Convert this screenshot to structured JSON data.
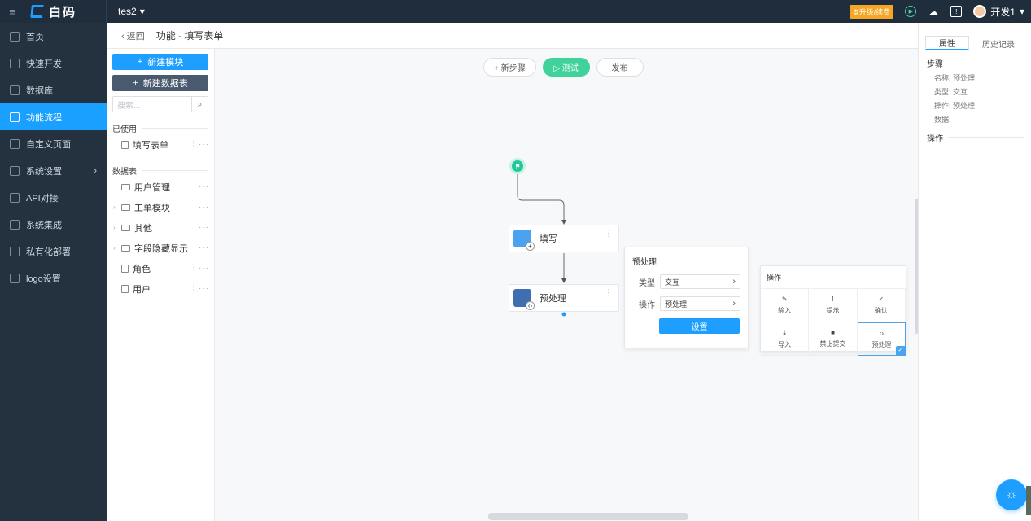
{
  "topbar": {
    "menu_icon": "≡",
    "logo_text": "白码",
    "project": "tes2",
    "upgrade_label": "升级/续费",
    "user_name": "开发1"
  },
  "sidebar": {
    "items": [
      {
        "label": "首页",
        "icon": "home-icon"
      },
      {
        "label": "快速开发",
        "icon": "cube-icon"
      },
      {
        "label": "数据库",
        "icon": "database-icon"
      },
      {
        "label": "功能流程",
        "icon": "flow-icon"
      },
      {
        "label": "自定义页面",
        "icon": "page-icon"
      },
      {
        "label": "系统设置",
        "icon": "monitor-icon"
      },
      {
        "label": "API对接",
        "icon": "api-icon"
      },
      {
        "label": "系统集成",
        "icon": "integration-icon"
      },
      {
        "label": "私有化部署",
        "icon": "deploy-icon"
      },
      {
        "label": "logo设置",
        "icon": "logo-icon"
      }
    ]
  },
  "subbar": {
    "back_label": "返回",
    "breadcrumb": "功能 - 填写表单"
  },
  "leftpanel": {
    "new_module": "新建模块",
    "new_table": "新建数据表",
    "search_placeholder": "搜索...",
    "used_section": "已使用",
    "used_items": [
      "填写表单"
    ],
    "tables_section": "数据表",
    "table_items": [
      "用户管理",
      "工单模块",
      "其他",
      "字段隐藏显示",
      "角色",
      "用户"
    ]
  },
  "canvas": {
    "add_step": "+ 新步骤",
    "test": "▷ 测试",
    "publish": "发布",
    "node1_label": "填写",
    "node2_label": "预处理"
  },
  "preprocess_panel": {
    "title": "预处理",
    "type_label": "类型",
    "type_value": "交互",
    "op_label": "操作",
    "op_value": "预处理",
    "set_button": "设置"
  },
  "op_panel": {
    "title": "操作",
    "items": [
      "输入",
      "提示",
      "确认",
      "导入",
      "禁止提交",
      "预处理"
    ]
  },
  "rightpanel": {
    "tab_props": "属性",
    "tab_history": "历史记录",
    "step_section": "步骤",
    "name_line": "名称: 预处理",
    "type_line": "类型: 交互",
    "op_line": "操作: 预处理",
    "data_line": "数据:",
    "op_section": "操作"
  }
}
